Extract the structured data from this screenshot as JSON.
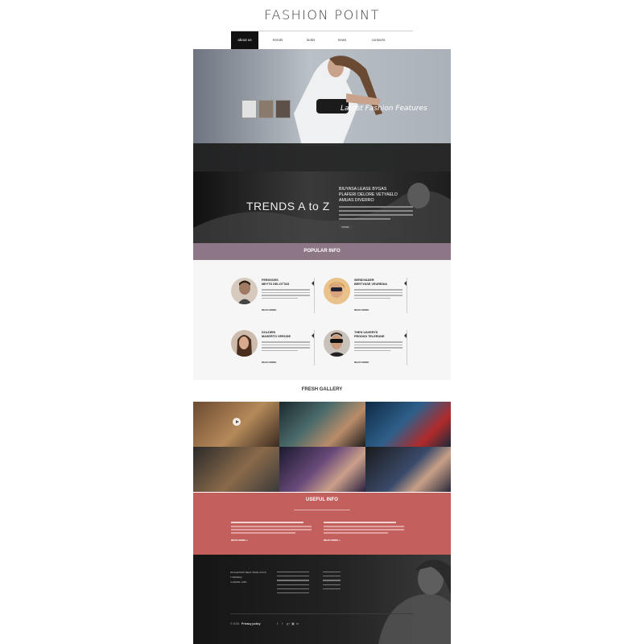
{
  "header": {
    "logo": "FASHION POINT",
    "nav": [
      "about us",
      "trends",
      "looks",
      "news",
      "contacts"
    ]
  },
  "hero": {
    "caption": "Latest Fashion Features"
  },
  "trends": {
    "title": "TRENDS A to Z",
    "heading_lines": [
      "BIUYASA LEASE BYGAS",
      "PLAFERI DELORE VETYAELO",
      "AMUAS DIVERRO"
    ],
    "button": "MORE"
  },
  "popular": {
    "title": "POPULAR INFO",
    "cards": [
      {
        "title_lines": [
          "FERIGIOES",
          "MEYTS DELOTTAS"
        ],
        "more": "READ MORE"
      },
      {
        "title_lines": [
          "SERDIVADER",
          "BERTYASE VEUREDIA"
        ],
        "more": "READ MORE"
      },
      {
        "title_lines": [
          "DOLDERI",
          "MASERTO VERODE"
        ],
        "more": "READ MORE"
      },
      {
        "title_lines": [
          "THEN UAVERYS",
          "PRODIGI TELERUNE"
        ],
        "more": "READ MORE"
      }
    ]
  },
  "gallery": {
    "title": "FRESH GALLERY"
  },
  "useful": {
    "title": "USEFUL INFO",
    "more_left": "READ MORE",
    "more_right": "READ MORE"
  },
  "footer": {
    "address": [
      "DILIGESSOS BEAT ZEDE ZOOS",
      "TVBOREQ",
      "4-HEWAL 2081"
    ],
    "copyright": "© 2015",
    "policy": "Privacy policy",
    "social": [
      "f",
      "t",
      "g+",
      "▣",
      "in"
    ]
  },
  "colors": {
    "nav_active": "#111111",
    "popular_bar": "#8d7787",
    "useful_bg": "#c2605e"
  }
}
